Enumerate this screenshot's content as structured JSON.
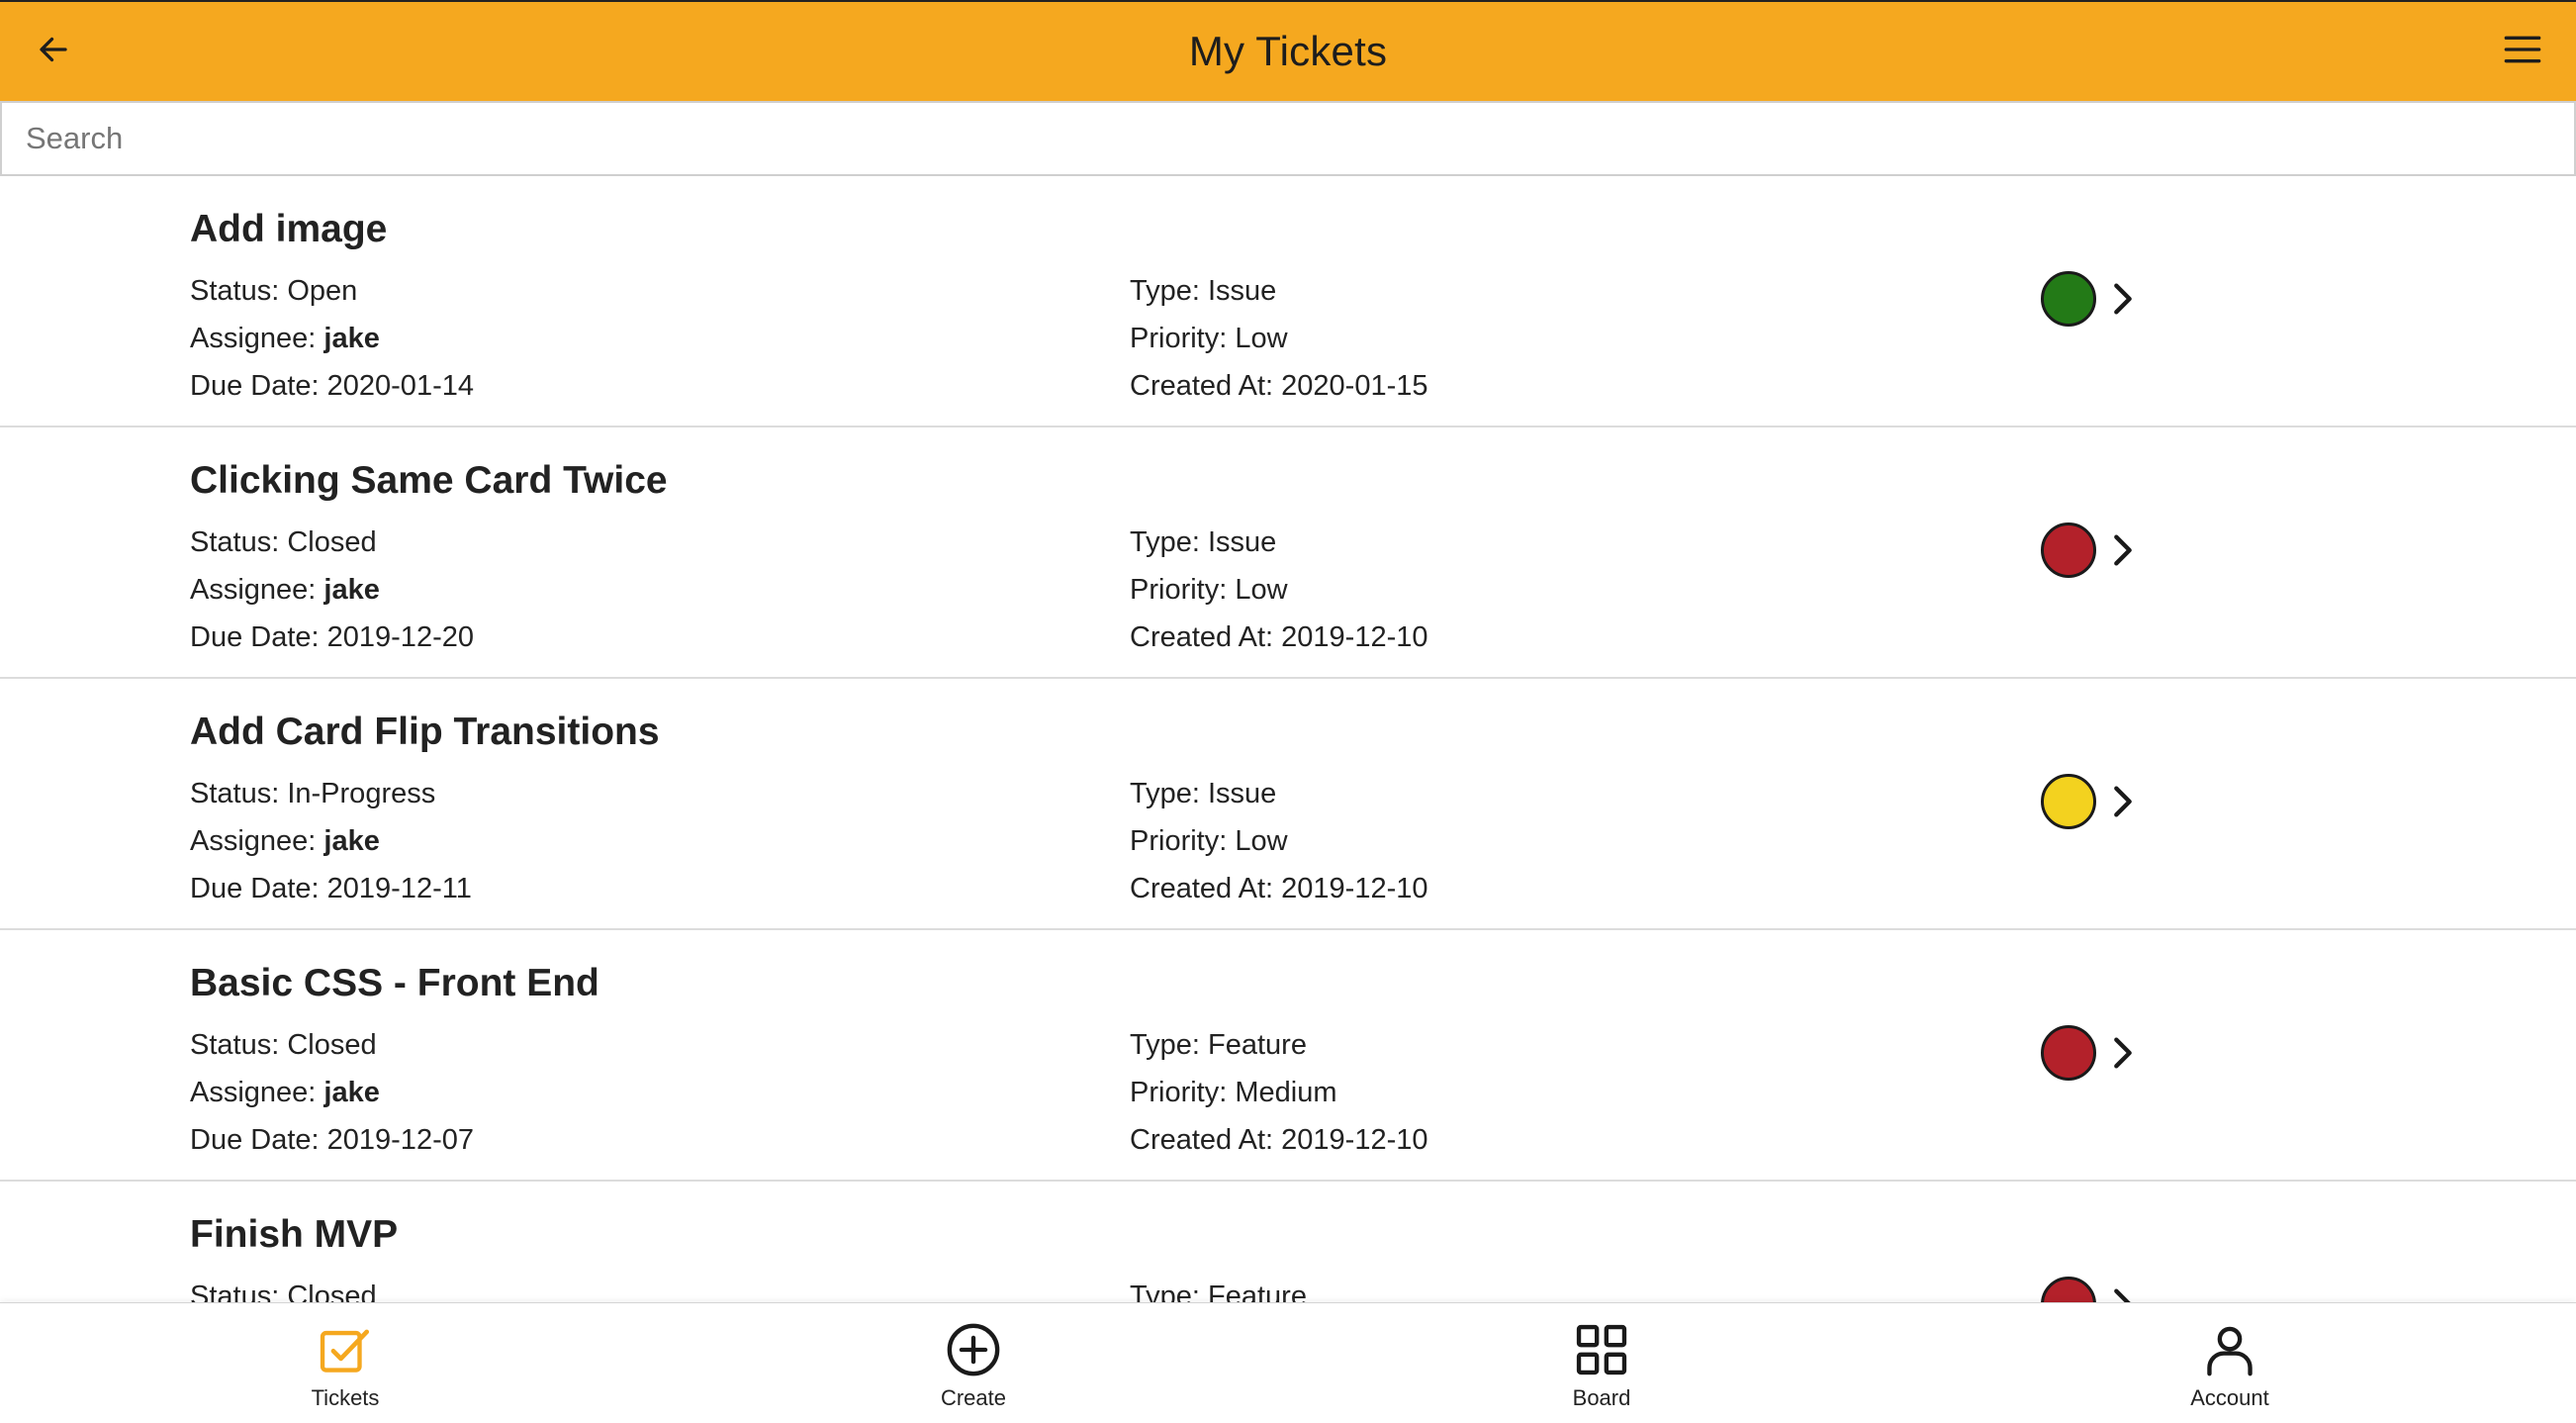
{
  "header": {
    "title": "My Tickets",
    "back_icon": "arrow-left-icon",
    "menu_icon": "hamburger-menu-icon",
    "accent_color": "#f5a81f"
  },
  "search": {
    "placeholder": "Search",
    "value": ""
  },
  "status_colors": {
    "open": "#237a17",
    "closed": "#b3212a",
    "in_progress": "#f3d21f"
  },
  "tickets": [
    {
      "title": "Add image",
      "status_label": "Status:",
      "status": "Open",
      "assignee_label": "Assignee:",
      "assignee": "jake",
      "due_label": "Due Date:",
      "due_date": "2020-01-14",
      "type_label": "Type:",
      "type": "Issue",
      "priority_label": "Priority:",
      "priority": "Low",
      "created_label": "Created At:",
      "created_at": "2020-01-15",
      "indicator_color": "#237a17"
    },
    {
      "title": "Clicking Same Card Twice",
      "status_label": "Status:",
      "status": "Closed",
      "assignee_label": "Assignee:",
      "assignee": "jake",
      "due_label": "Due Date:",
      "due_date": "2019-12-20",
      "type_label": "Type:",
      "type": "Issue",
      "priority_label": "Priority:",
      "priority": "Low",
      "created_label": "Created At:",
      "created_at": "2019-12-10",
      "indicator_color": "#b3212a"
    },
    {
      "title": "Add Card Flip Transitions",
      "status_label": "Status:",
      "status": "In-Progress",
      "assignee_label": "Assignee:",
      "assignee": "jake",
      "due_label": "Due Date:",
      "due_date": "2019-12-11",
      "type_label": "Type:",
      "type": "Issue",
      "priority_label": "Priority:",
      "priority": "Low",
      "created_label": "Created At:",
      "created_at": "2019-12-10",
      "indicator_color": "#f3d21f"
    },
    {
      "title": "Basic CSS - Front End",
      "status_label": "Status:",
      "status": "Closed",
      "assignee_label": "Assignee:",
      "assignee": "jake",
      "due_label": "Due Date:",
      "due_date": "2019-12-07",
      "type_label": "Type:",
      "type": "Feature",
      "priority_label": "Priority:",
      "priority": "Medium",
      "created_label": "Created At:",
      "created_at": "2019-12-10",
      "indicator_color": "#b3212a"
    },
    {
      "title": "Finish MVP",
      "status_label": "Status:",
      "status": "Closed",
      "type_label": "Type:",
      "type": "Feature",
      "indicator_color": "#b3212a"
    }
  ],
  "tabbar": {
    "tabs": [
      {
        "label": "Tickets",
        "icon": "checkbox-icon",
        "active": true
      },
      {
        "label": "Create",
        "icon": "plus-circle-icon",
        "active": false
      },
      {
        "label": "Board",
        "icon": "grid-icon",
        "active": false
      },
      {
        "label": "Account",
        "icon": "person-icon",
        "active": false
      }
    ]
  }
}
